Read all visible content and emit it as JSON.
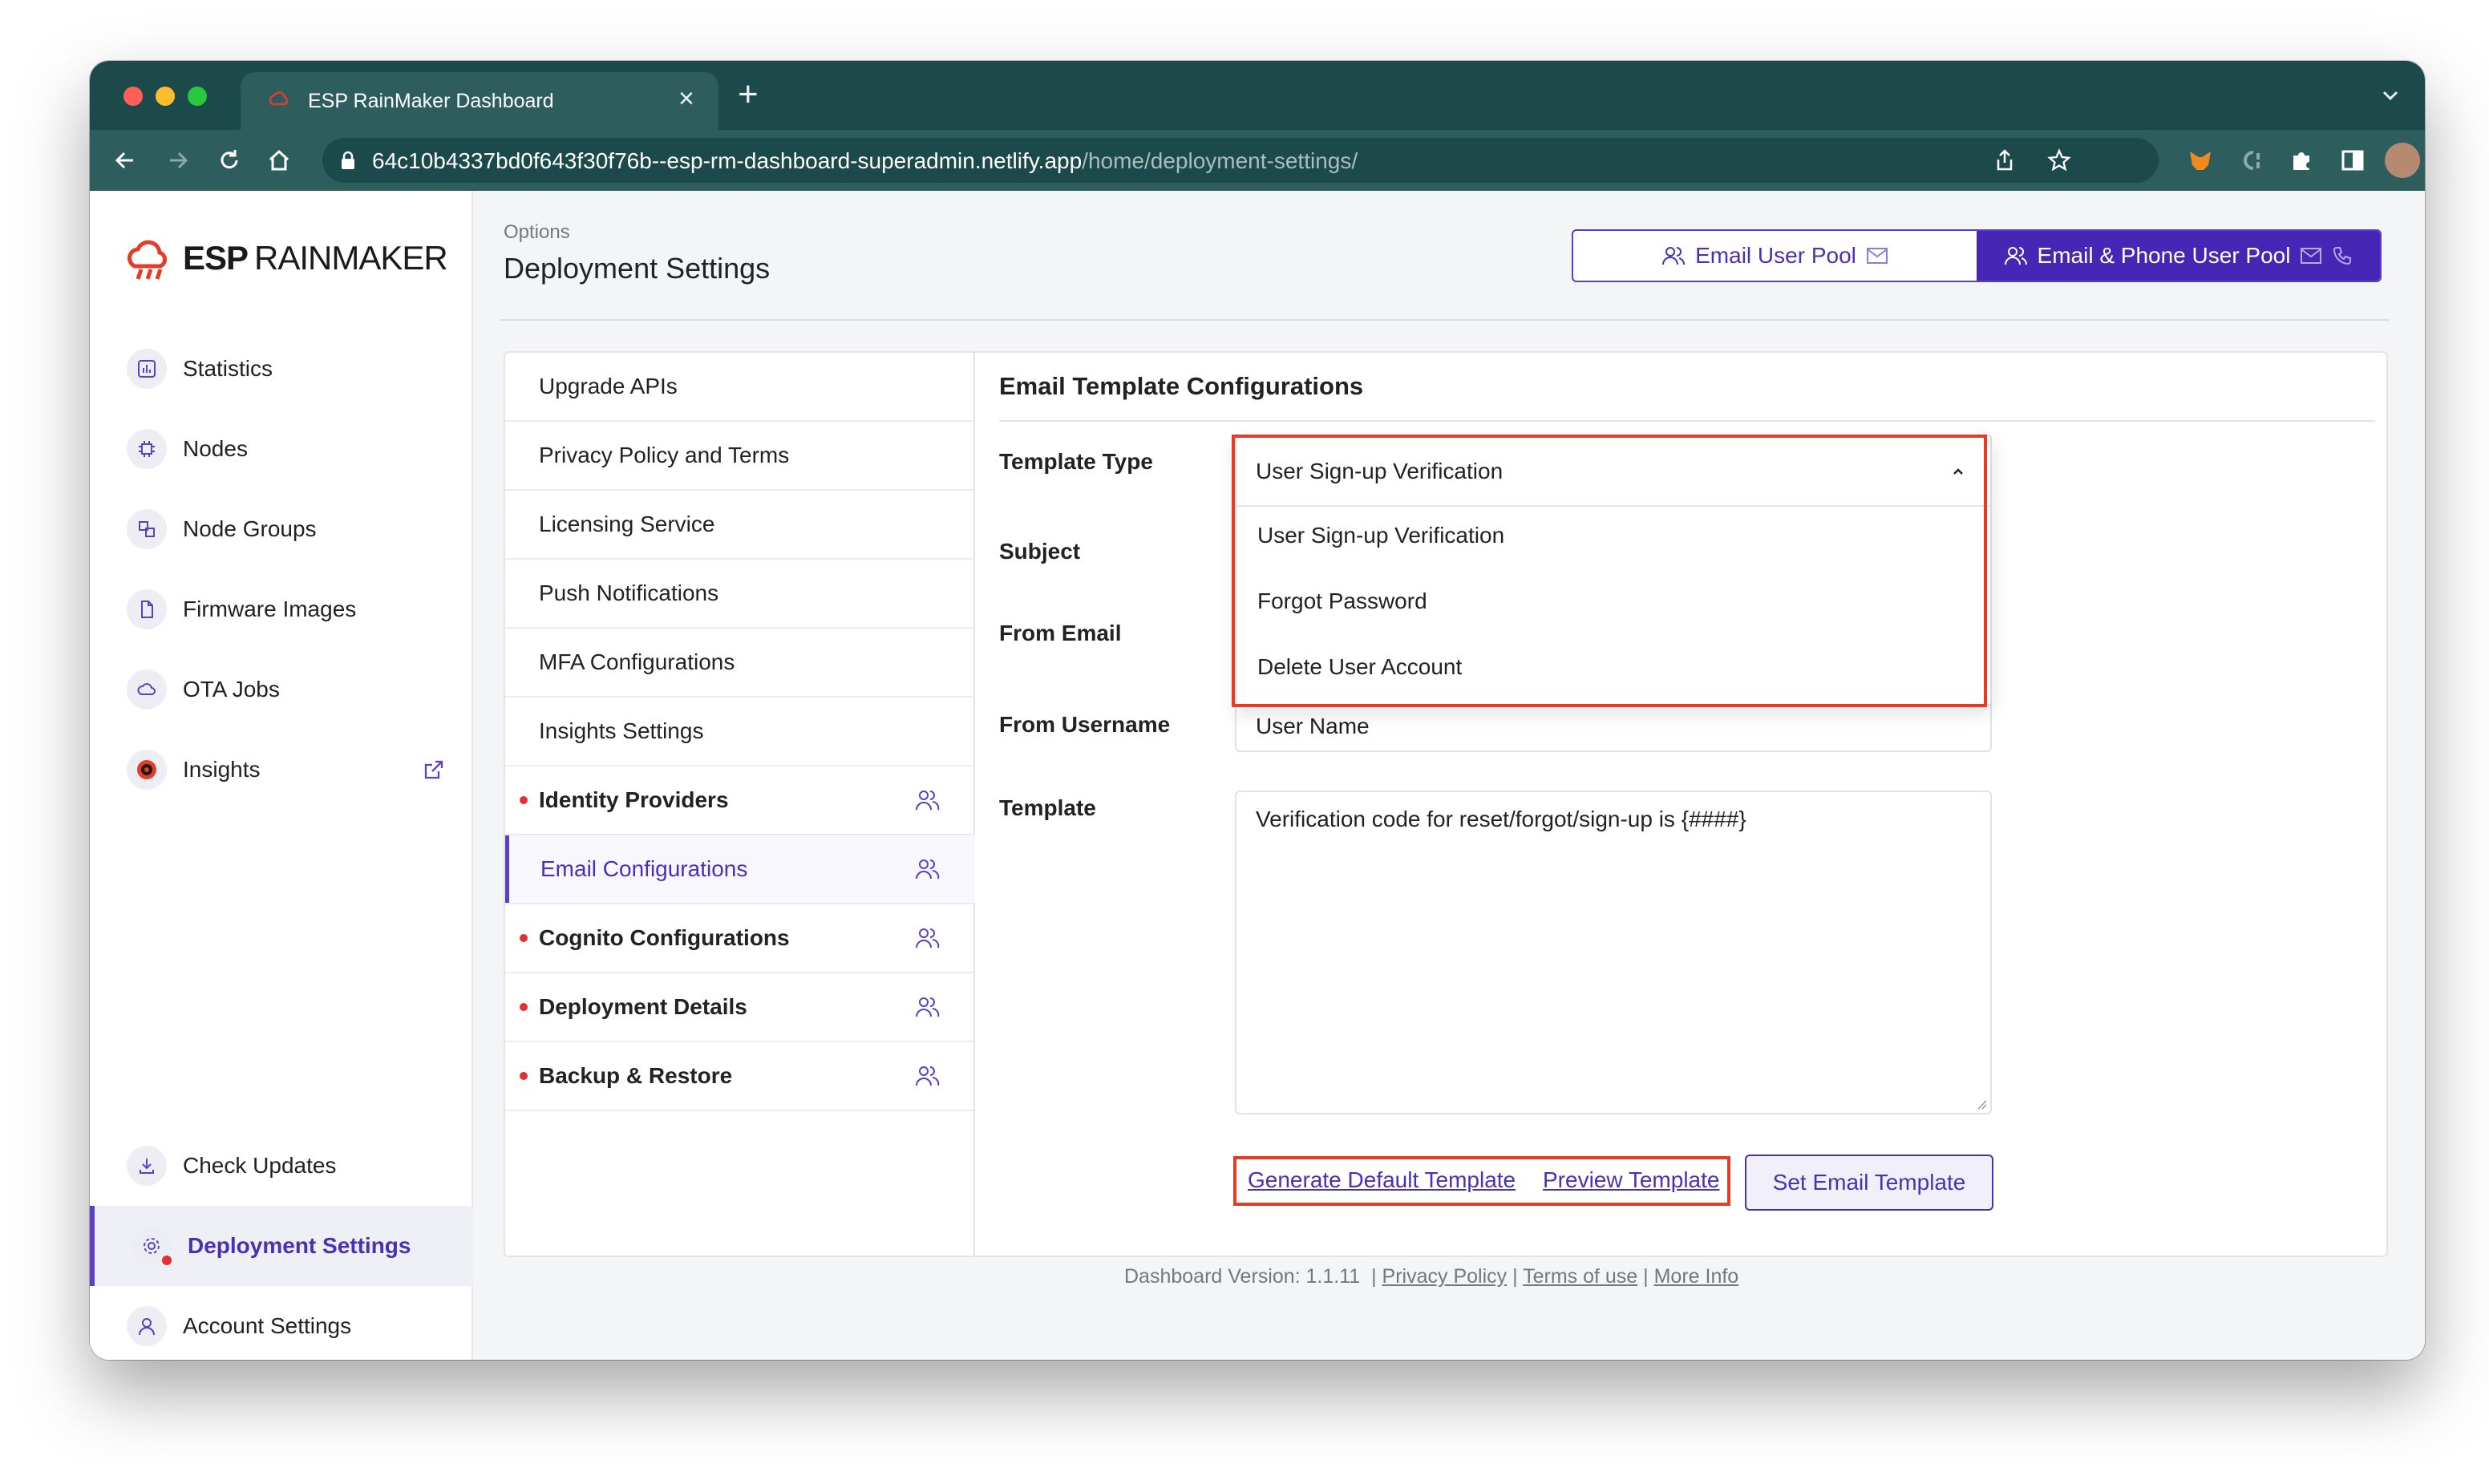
{
  "browser": {
    "tab_title": "ESP RainMaker Dashboard",
    "url_host": "64c10b4337bd0f643f30f76b--esp-rm-dashboard-superadmin.netlify.app",
    "url_path": "/home/deployment-settings/"
  },
  "brand": {
    "part1": "ESP",
    "part2": "RAINMAKER"
  },
  "sidebar": {
    "items": [
      {
        "label": "Statistics",
        "icon": "bar-chart-icon"
      },
      {
        "label": "Nodes",
        "icon": "chip-icon"
      },
      {
        "label": "Node Groups",
        "icon": "node-groups-icon"
      },
      {
        "label": "Firmware Images",
        "icon": "file-icon"
      },
      {
        "label": "OTA Jobs",
        "icon": "cloud-icon"
      },
      {
        "label": "Insights",
        "icon": "insights-icon"
      }
    ],
    "bottom_items": [
      {
        "label": "Check Updates",
        "icon": "download-icon"
      },
      {
        "label": "Deployment Settings",
        "icon": "gear-icon"
      },
      {
        "label": "Account Settings",
        "icon": "user-icon"
      }
    ]
  },
  "header": {
    "breadcrumb": "Options",
    "title": "Deployment Settings",
    "pool_email": "Email User Pool",
    "pool_email_phone": "Email & Phone User Pool"
  },
  "settings_list": [
    {
      "label": "Upgrade APIs"
    },
    {
      "label": "Privacy Policy and Terms"
    },
    {
      "label": "Licensing Service"
    },
    {
      "label": "Push Notifications"
    },
    {
      "label": "MFA Configurations"
    },
    {
      "label": "Insights Settings"
    },
    {
      "label": "Identity Providers"
    },
    {
      "label": "Email Configurations"
    },
    {
      "label": "Cognito Configurations"
    },
    {
      "label": "Deployment Details"
    },
    {
      "label": "Backup & Restore"
    }
  ],
  "form": {
    "title": "Email Template Configurations",
    "template_type_label": "Template Type",
    "subject_label": "Subject",
    "from_email_label": "From Email",
    "from_username_label": "From Username",
    "template_label": "Template",
    "template_type_value": "User Sign-up Verification",
    "template_type_options": [
      "User Sign-up Verification",
      "Forgot Password",
      "Delete User Account"
    ],
    "from_username_value": "User Name",
    "template_value": "Verification code for reset/forgot/sign-up is {####}",
    "generate_default": "Generate Default Template",
    "preview": "Preview Template",
    "set_template": "Set Email Template"
  },
  "footer": {
    "version": "Dashboard Version: 1.1.11",
    "sep": "|",
    "privacy": "Privacy Policy",
    "terms": "Terms of use",
    "more": "More Info"
  },
  "colors": {
    "accent": "#4b2fb5",
    "highlight": "#e23d28",
    "browser_frame": "#1c4a4a"
  }
}
